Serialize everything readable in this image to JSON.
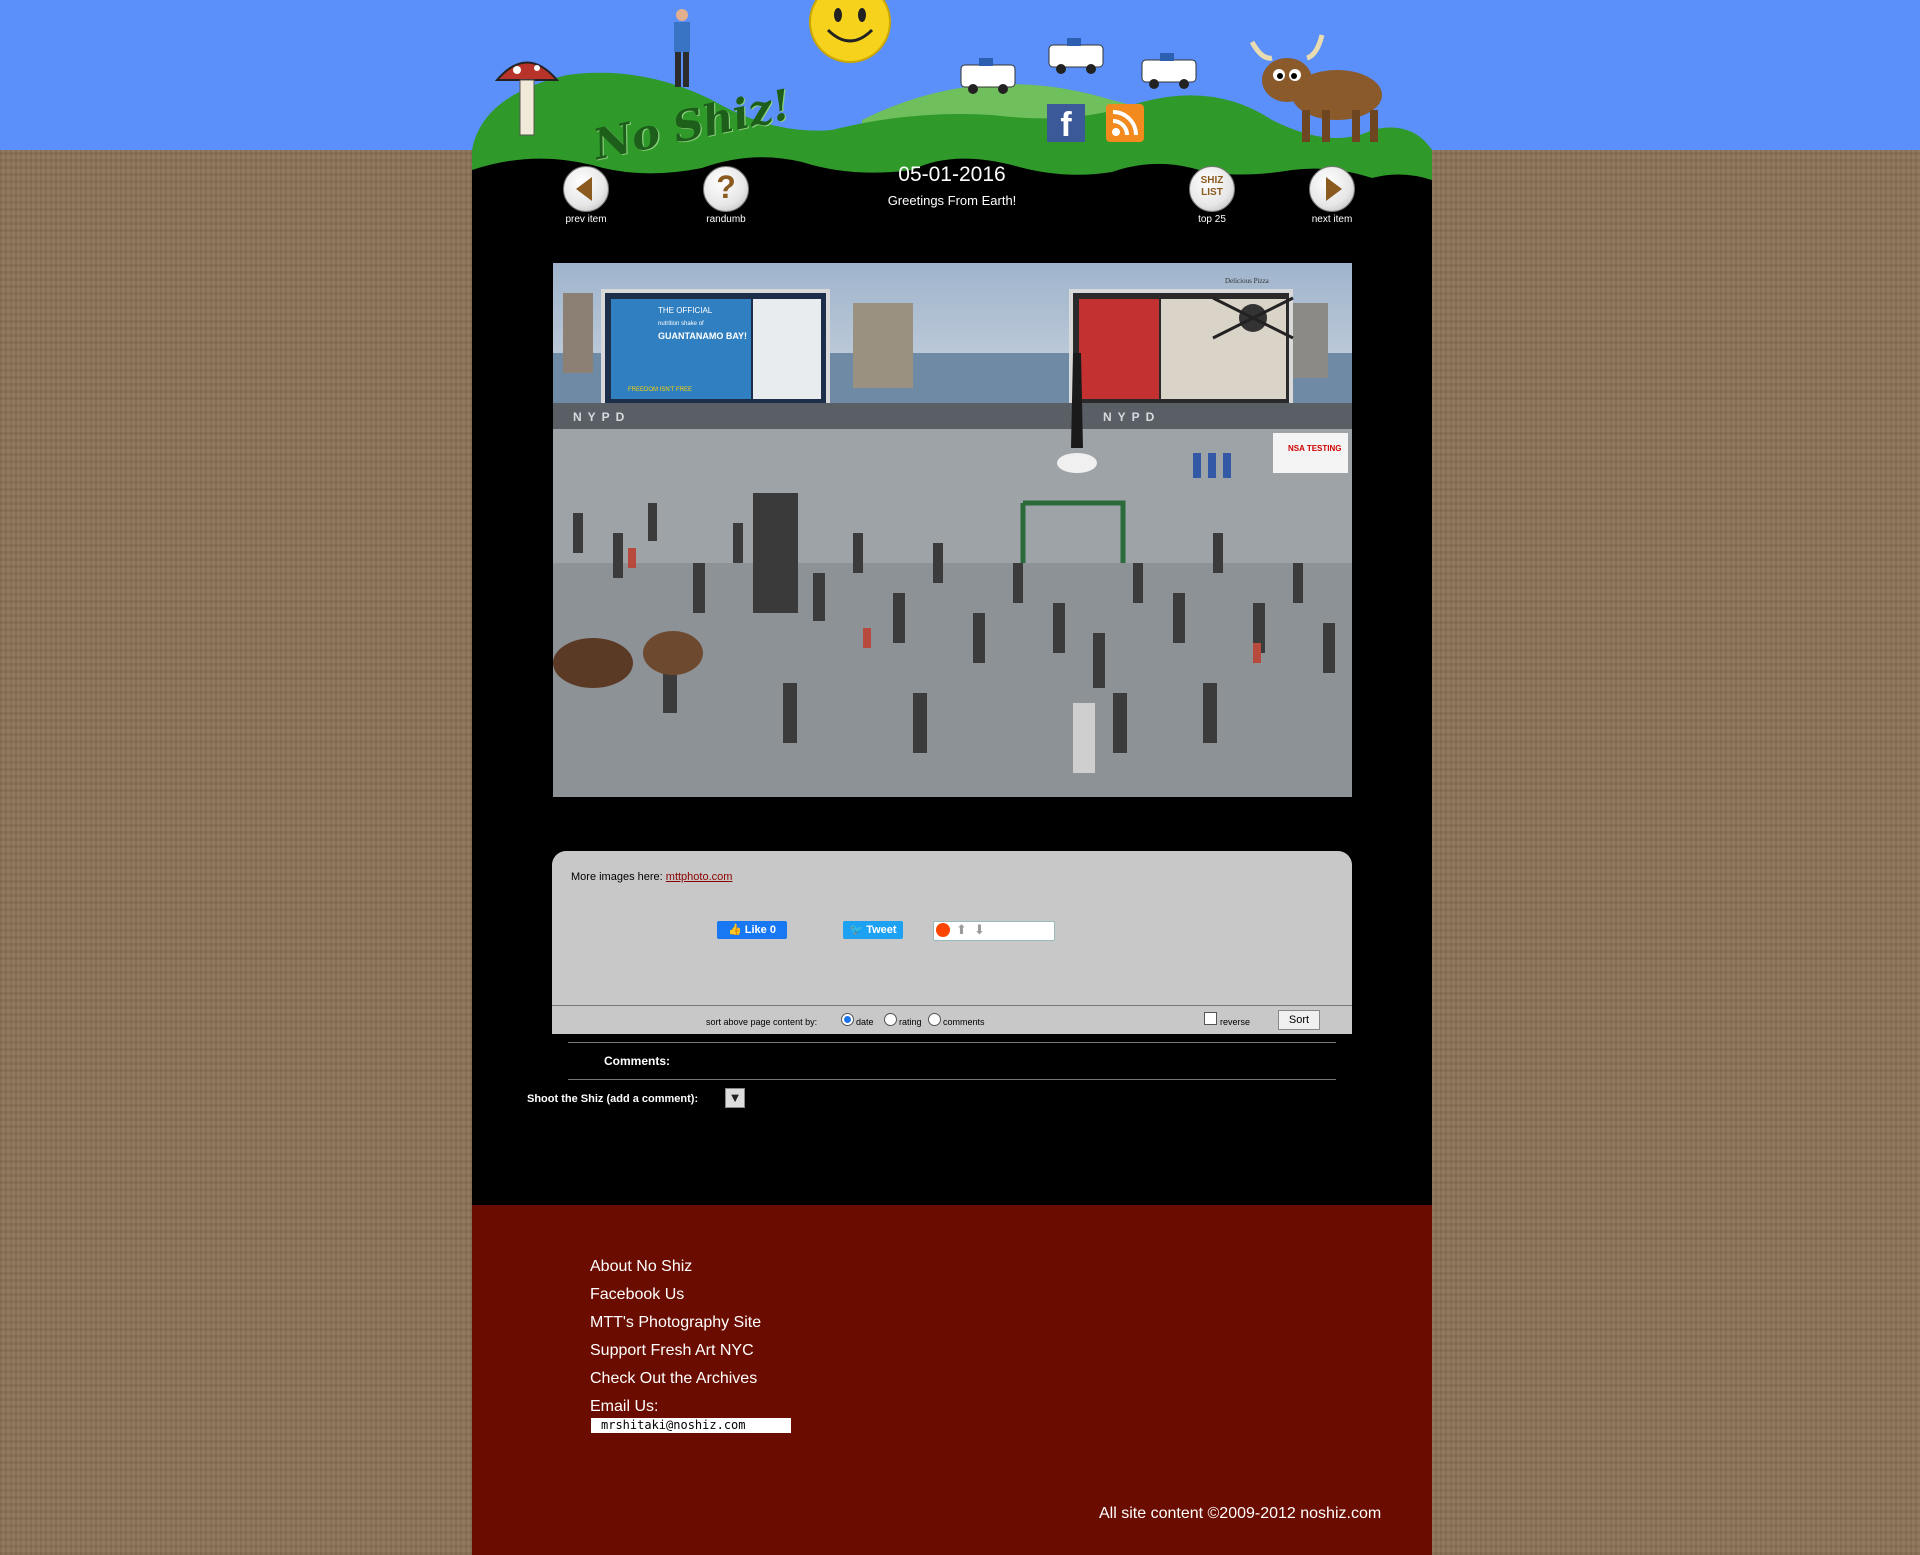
{
  "site": {
    "logo_text": "No Shiz!"
  },
  "nav": {
    "prev_label": "prev item",
    "random_label": "randumb",
    "top25_label": "top 25",
    "top25_badge": "SHIZ LIST",
    "next_label": "next item"
  },
  "post": {
    "date": "05-01-2016",
    "title": "Greetings From Earth!"
  },
  "collage": {
    "billboard_left_title": "THE OFFICIAL",
    "billboard_left_sub": "nutrition shake of",
    "billboard_left_big": "GUANTANAMO BAY!",
    "billboard_left_foot": "FREEDOM ISN'T FREE",
    "nypd_text": "NYPD",
    "pizza_sign": "Delicious Pizza",
    "nsa_sign": "NSA TESTING"
  },
  "info": {
    "more_images_prefix": "More images here:",
    "more_images_link": "mttphoto.com",
    "like_label": "Like 0",
    "tweet_label": "Tweet"
  },
  "sort": {
    "label": "sort above page content by:",
    "options": [
      "date",
      "rating",
      "comments"
    ],
    "selected": "date",
    "reverse_label": "reverse",
    "button": "Sort"
  },
  "comments": {
    "label": "Comments:",
    "add_label": "Shoot the Shiz (add a comment):",
    "toggle_glyph": "▼"
  },
  "footer": {
    "links": [
      "About No Shiz",
      "Facebook Us",
      "MTT's Photography Site",
      "Support Fresh Art NYC",
      "Check Out the Archives"
    ],
    "email_label": "Email Us:",
    "email": "mrshitaki@noshiz.com",
    "copyright": "All site content ©2009-2012 noshiz.com"
  },
  "colors": {
    "sky": "#5b8ff9",
    "grass": "#2f9a2a",
    "footer": "#6b0c00",
    "facebook": "#3b5998",
    "rss": "#f28a1e"
  }
}
